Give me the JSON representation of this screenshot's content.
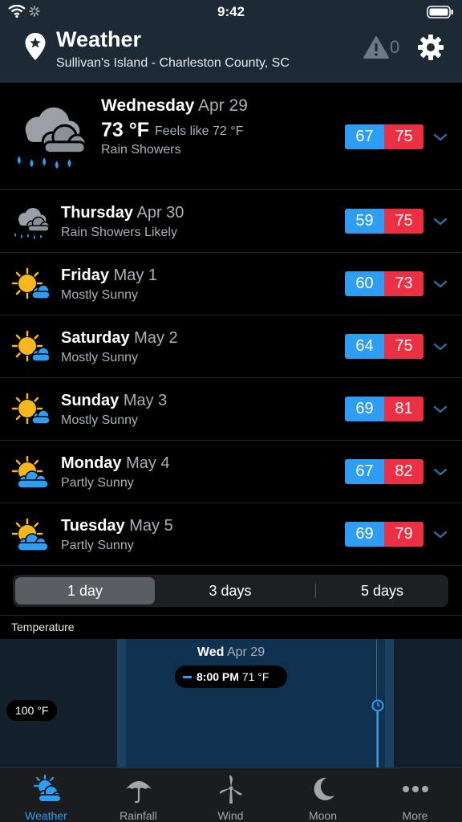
{
  "status": {
    "time": "9:42"
  },
  "header": {
    "title": "Weather",
    "location": "Sullivan's Island - Charleston County, SC",
    "alert_count": "0"
  },
  "today": {
    "day": "Wednesday",
    "date": "Apr 29",
    "temp": "73 °F",
    "feels": "Feels like 72 °F",
    "condition": "Rain Showers",
    "low": "67",
    "high": "75",
    "icon": "rain-cloud-icon"
  },
  "days": [
    {
      "day": "Thursday",
      "date": "Apr 30",
      "condition": "Rain Showers Likely",
      "low": "59",
      "high": "75",
      "icon": "rain-cloud-icon"
    },
    {
      "day": "Friday",
      "date": "May 1",
      "condition": "Mostly Sunny",
      "low": "60",
      "high": "73",
      "icon": "sun-cloud-icon"
    },
    {
      "day": "Saturday",
      "date": "May 2",
      "condition": "Mostly Sunny",
      "low": "64",
      "high": "75",
      "icon": "sun-cloud-icon"
    },
    {
      "day": "Sunday",
      "date": "May 3",
      "condition": "Mostly Sunny",
      "low": "69",
      "high": "81",
      "icon": "sun-cloud-icon"
    },
    {
      "day": "Monday",
      "date": "May 4",
      "condition": "Partly Sunny",
      "low": "67",
      "high": "82",
      "icon": "partly-sunny-icon"
    },
    {
      "day": "Tuesday",
      "date": "May 5",
      "condition": "Partly Sunny",
      "low": "69",
      "high": "79",
      "icon": "partly-sunny-icon"
    }
  ],
  "segments": {
    "options": [
      "1 day",
      "3 days",
      "5 days"
    ],
    "selected": "1 day"
  },
  "section": {
    "label": "Temperature"
  },
  "chart": {
    "day": "Wed",
    "date": "Apr 29",
    "readout_time": "8:00 PM",
    "readout_value": "71 °F",
    "y_label": "100 °F"
  },
  "tabs": [
    {
      "label": "Weather",
      "icon": "weather-icon",
      "active": true
    },
    {
      "label": "Rainfall",
      "icon": "umbrella-icon",
      "active": false
    },
    {
      "label": "Wind",
      "icon": "wind-turbine-icon",
      "active": false
    },
    {
      "label": "Moon",
      "icon": "moon-icon",
      "active": false
    },
    {
      "label": "More",
      "icon": "more-icon",
      "active": false
    }
  ],
  "colors": {
    "header_bg": "#1d2a36",
    "low": "#2d9ef3",
    "high": "#ec2f43",
    "accent": "#2d9ef3"
  }
}
